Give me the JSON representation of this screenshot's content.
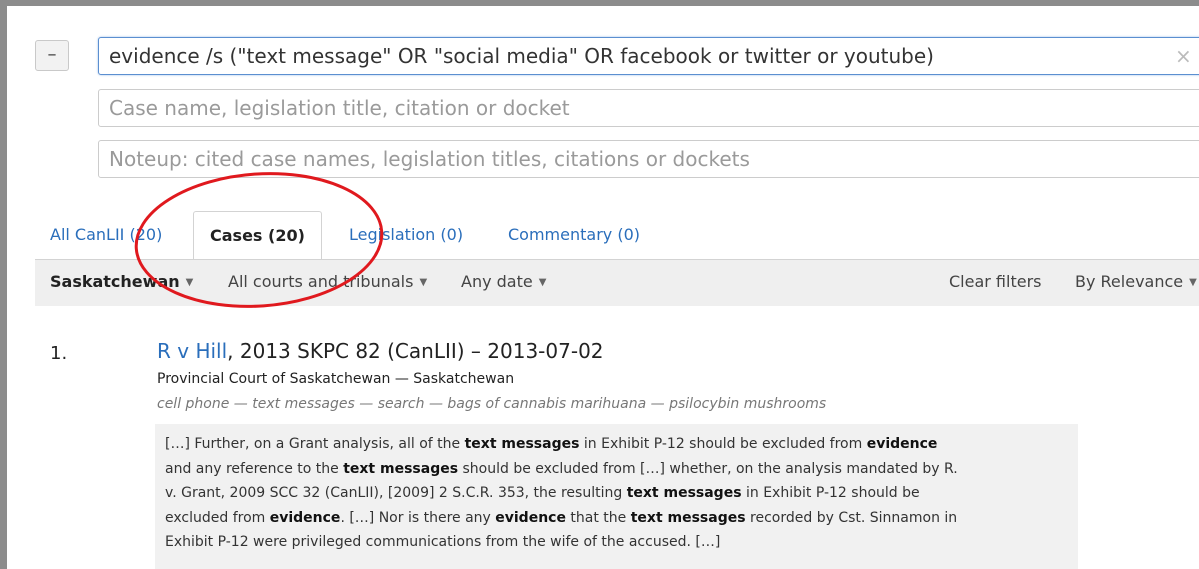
{
  "search": {
    "collapse_label": "–",
    "query": "evidence /s (\"text message\" OR \"social media\" OR facebook or twitter or youtube)",
    "clear_icon": "×",
    "case_placeholder": "Case name, legislation title, citation or docket",
    "noteup_placeholder": "Noteup: cited case names, legislation titles, citations or dockets"
  },
  "tabs": [
    {
      "label": "All CanLII (20)"
    },
    {
      "label": "Cases (20)"
    },
    {
      "label": "Legislation (0)"
    },
    {
      "label": "Commentary (0)"
    }
  ],
  "filters": {
    "jurisdiction": "Saskatchewan",
    "courts": "All courts and tribunals",
    "date": "Any date",
    "clear": "Clear filters",
    "sort": "By Relevance",
    "caret": "▼"
  },
  "results": [
    {
      "num": "1.",
      "title_link": "R v Hill",
      "title_rest": ", 2013 SKPC 82 (CanLII) – 2013-07-02",
      "court": "Provincial Court of Saskatchewan — Saskatchewan",
      "keywords": "cell phone — text messages — search — bags of cannabis marihuana — psilocybin mushrooms",
      "snippet": [
        [
          "[…]  Further, on a Grant analysis, all of the ",
          "text messages",
          " in Exhibit P-12 should be excluded from ",
          "evidence",
          ""
        ],
        [
          "and any reference to the ",
          "text messages",
          " should be excluded from   […]  whether, on the analysis mandated by R.",
          "",
          ""
        ],
        [
          "v. Grant, 2009 SCC 32 (CanLII), [2009] 2 S.C.R. 353, the resulting ",
          "text messages",
          " in Exhibit P-12 should be",
          "",
          ""
        ],
        [
          "excluded from ",
          "evidence",
          ".  […]   Nor is there any ",
          "evidence",
          " that the "
        ],
        [
          "Exhibit P-12 were privileged communications from the wife of the accused.  […]",
          "",
          "",
          "",
          ""
        ]
      ],
      "snippet_line4_tail": [
        "text messages",
        " recorded by Cst. Sinnamon in"
      ]
    }
  ],
  "annotation": {
    "color": "#e0191e"
  }
}
